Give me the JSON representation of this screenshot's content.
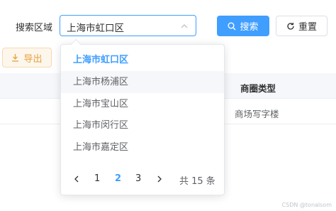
{
  "search": {
    "label": "搜索区域",
    "selected_value": "上海市虹口区",
    "search_button": "搜索",
    "reset_button": "重置"
  },
  "toolbar": {
    "export_button": "导出"
  },
  "table": {
    "column_header": "商圈类型",
    "row_value": "商场写字楼"
  },
  "dropdown": {
    "options": [
      "上海市虹口区",
      "上海市杨浦区",
      "上海市宝山区",
      "上海市闵行区",
      "上海市嘉定区"
    ],
    "selected_index": 0,
    "hover_index": 1
  },
  "pagination": {
    "pages": [
      "1",
      "2",
      "3"
    ],
    "current_page": "2",
    "total_text": "共 15 条"
  },
  "watermark": "CSDN @tonalsom",
  "colors": {
    "primary": "#409eff",
    "warning": "#e6a23c",
    "warning_bg": "#fdf6ec"
  }
}
